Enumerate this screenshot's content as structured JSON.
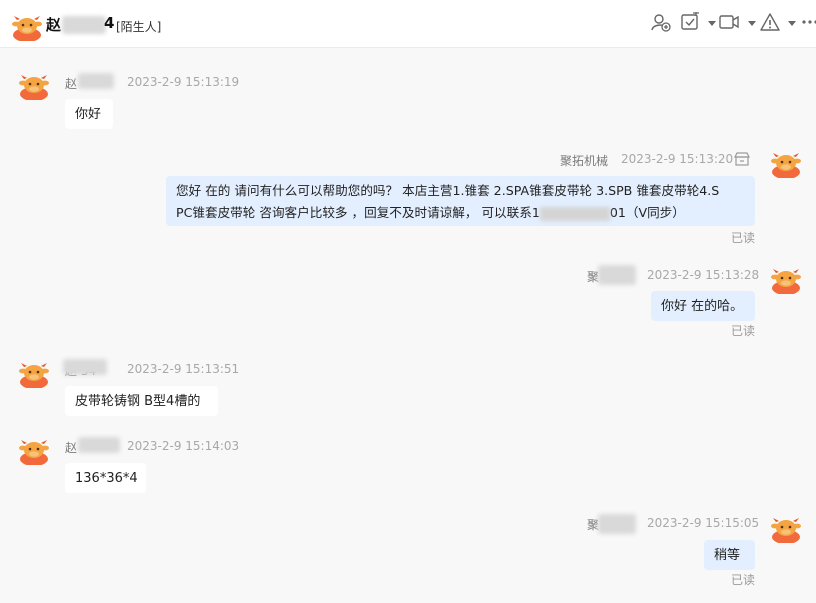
{
  "header": {
    "name_prefix": "赵",
    "name_suffix": "4",
    "tag": "[陌生人]"
  },
  "toolbar": {
    "icons": [
      "add-contact-icon",
      "task-check-icon",
      "video-call-icon",
      "warning-icon",
      "more-icon"
    ]
  },
  "messages": [
    {
      "side": "left",
      "sender_visible": "赵",
      "time": "2023-2-9 15:13:19",
      "text": "你好"
    },
    {
      "side": "right",
      "sender_visible": "聚拓机械",
      "time": "2023-2-9 15:13:20",
      "line1": "您好 在的 请问有什么可以帮助您的吗？ 本店主营1.锥套 2.SPA锥套皮带轮 3.SPB 锥套皮带轮4.S",
      "line2a": "PC锥套皮带轮 咨询客户比较多 ，回复不及时请谅解， 可以联系1",
      "line2b": "01（V同步）",
      "status": "已读"
    },
    {
      "side": "right",
      "sender_visible": "聚",
      "time": "2023-2-9 15:13:28",
      "text": "你好 在的哈。",
      "status": "已读"
    },
    {
      "side": "left",
      "sender_visible": "赵 54",
      "time": "2023-2-9 15:13:51",
      "text": "皮带轮铸钢 B型4槽的"
    },
    {
      "side": "left",
      "sender_visible": "赵",
      "time": "2023-2-9 15:14:03",
      "text": "136*36*4"
    },
    {
      "side": "right",
      "sender_visible": "聚",
      "time": "2023-2-9 15:15:05",
      "text": "稍等",
      "status": "已读"
    }
  ],
  "colors": {
    "right_bubble": "#e3efff",
    "left_bubble": "#ffffff",
    "avatar_orange": "#f26a3b",
    "avatar_face": "#f4a441"
  }
}
